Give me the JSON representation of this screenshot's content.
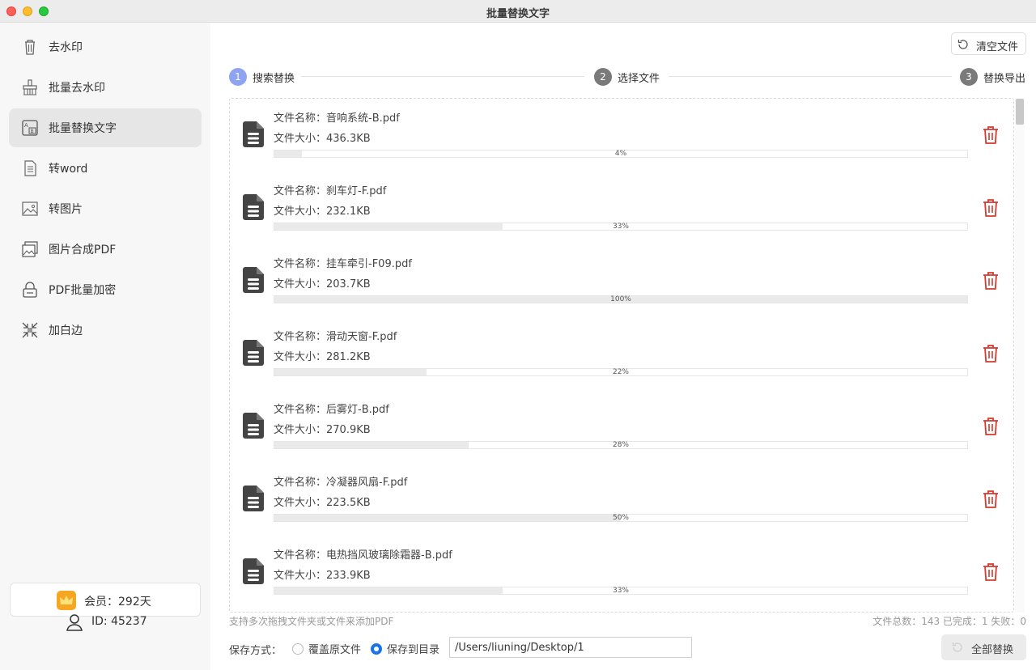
{
  "window": {
    "title": "批量替换文字"
  },
  "sidebar": {
    "items": [
      {
        "label": "去水印",
        "icon": "trash-icon",
        "active": false
      },
      {
        "label": "批量去水印",
        "icon": "broom-icon",
        "active": false
      },
      {
        "label": "批量替换文字",
        "icon": "text-replace-icon",
        "active": true
      },
      {
        "label": "转word",
        "icon": "document-icon",
        "active": false
      },
      {
        "label": "转图片",
        "icon": "image-icon",
        "active": false
      },
      {
        "label": "图片合成PDF",
        "icon": "images-icon",
        "active": false
      },
      {
        "label": "PDF批量加密",
        "icon": "lock-icon",
        "active": false
      },
      {
        "label": "加白边",
        "icon": "shrink-icon",
        "active": false
      }
    ],
    "member": "会员：292天",
    "user_id": "ID: 45237"
  },
  "toolbar": {
    "clear_label": "清空文件"
  },
  "steps": [
    {
      "num": "1",
      "label": "搜索替换",
      "active": true
    },
    {
      "num": "2",
      "label": "选择文件",
      "active": false
    },
    {
      "num": "3",
      "label": "替换导出",
      "active": false
    }
  ],
  "files": [
    {
      "name": "文件名称：音响系统-B.pdf",
      "size": "文件大小：436.3KB",
      "progress": 4,
      "progress_label": "4%"
    },
    {
      "name": "文件名称：刹车灯-F.pdf",
      "size": "文件大小：232.1KB",
      "progress": 33,
      "progress_label": "33%"
    },
    {
      "name": "文件名称：挂车牵引-F09.pdf",
      "size": "文件大小：203.7KB",
      "progress": 100,
      "progress_label": "100%"
    },
    {
      "name": "文件名称：滑动天窗-F.pdf",
      "size": "文件大小：281.2KB",
      "progress": 22,
      "progress_label": "22%"
    },
    {
      "name": "文件名称：后雾灯-B.pdf",
      "size": "文件大小：270.9KB",
      "progress": 28,
      "progress_label": "28%"
    },
    {
      "name": "文件名称：冷凝器风扇-F.pdf",
      "size": "文件大小：223.5KB",
      "progress": 50,
      "progress_label": "50%"
    },
    {
      "name": "文件名称：电热挡风玻璃除霜器-B.pdf",
      "size": "文件大小：233.9KB",
      "progress": 33,
      "progress_label": "33%"
    }
  ],
  "footer": {
    "hint": "支持多次拖拽文件夹或文件来添加PDF",
    "stats": "文件总数：143 已完成：1 失败：0",
    "save_label": "保存方式：",
    "option_overwrite": "覆盖原文件",
    "option_save_dir": "保存到目录",
    "selected_option": "保存到目录",
    "path_value": "/Users/liuning/Desktop/1",
    "replace_all_label": "全部替换"
  },
  "colors": {
    "accent": "#1a73e8",
    "step_active": "#8ea4f2",
    "step_inactive": "#7a7a7a",
    "delete": "#d43a2f",
    "crown": "#f6a623"
  }
}
